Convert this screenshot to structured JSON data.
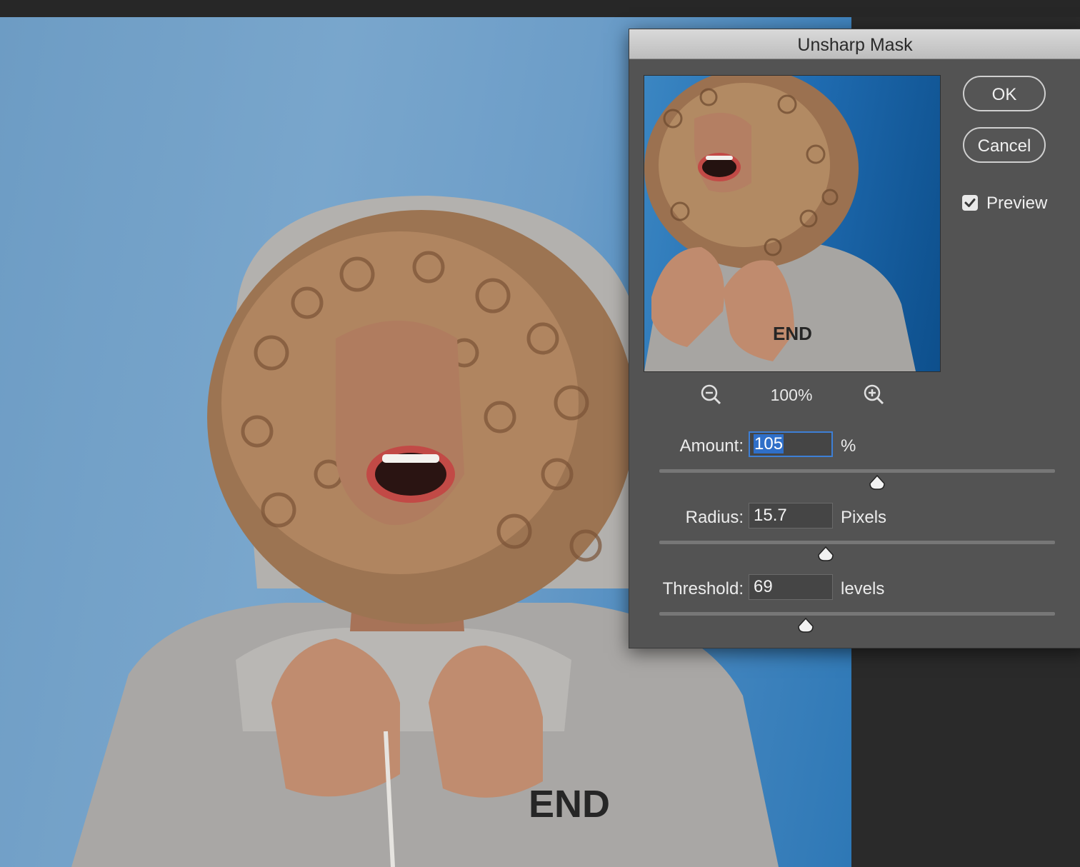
{
  "dialog": {
    "title": "Unsharp Mask",
    "ok_label": "OK",
    "cancel_label": "Cancel",
    "preview_label": "Preview",
    "preview_checked": true,
    "zoom": "100%",
    "zoom_out_icon": "zoom-out-icon",
    "zoom_in_icon": "zoom-in-icon"
  },
  "params": {
    "amount": {
      "label": "Amount:",
      "value": "105",
      "unit": "%",
      "slider_fraction": 0.55
    },
    "radius": {
      "label": "Radius:",
      "value": "15.7",
      "unit": "Pixels",
      "slider_fraction": 0.42
    },
    "threshold": {
      "label": "Threshold:",
      "value": "69",
      "unit": "levels",
      "slider_fraction": 0.37
    }
  },
  "artwork": {
    "hoodie_text": "END",
    "preview_hoodie_text": "END"
  },
  "colors": {
    "dialog_bg": "#535353",
    "selection": "#2f6fc8",
    "focus_ring": "#3d7fd6"
  }
}
